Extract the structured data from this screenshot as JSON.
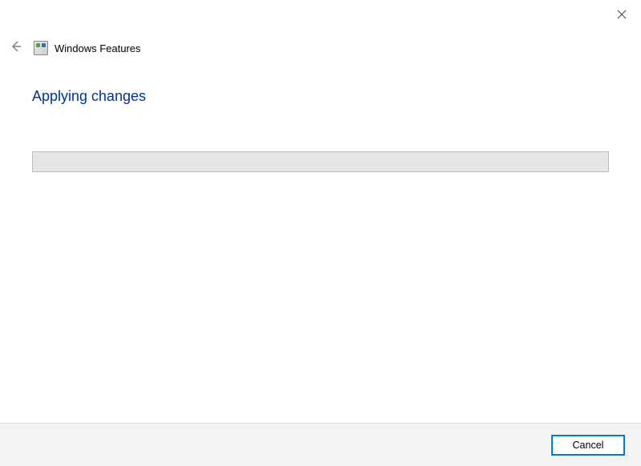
{
  "window": {
    "title": "Windows Features"
  },
  "main": {
    "heading": "Applying changes"
  },
  "footer": {
    "cancel_label": "Cancel"
  }
}
